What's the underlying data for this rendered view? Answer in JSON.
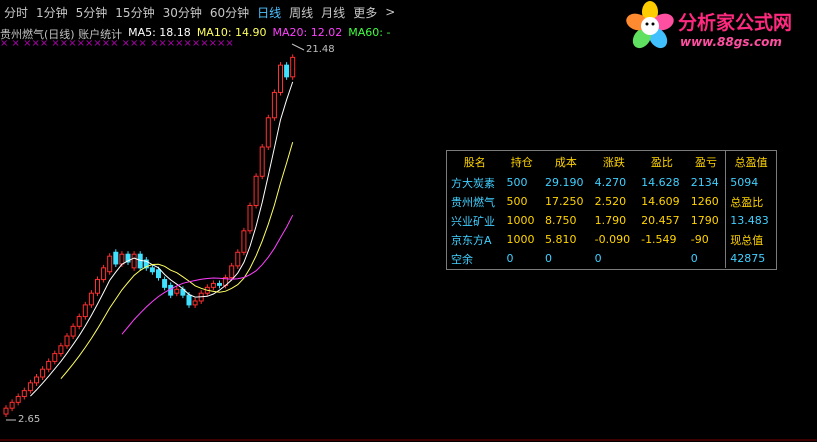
{
  "toolbar": {
    "items": [
      "分时",
      "1分钟",
      "5分钟",
      "15分钟",
      "30分钟",
      "60分钟",
      "日线",
      "周线",
      "月线",
      "更多"
    ],
    "active_index": 6,
    "more_chevron": ">"
  },
  "infobar": {
    "title": "贵州燃气(日线) 账户统计",
    "ma5": "MA5: 18.18",
    "ma10": "MA10: 14.90",
    "ma20": "MA20: 12.02",
    "ma60": "MA60: -",
    "colors": {
      "title": "#c0c0c0",
      "ma5": "#ffffff",
      "ma10": "#ffff60",
      "ma20": "#ff40ff",
      "ma60": "#40ff40"
    }
  },
  "marks": "×   ×  ×××    ××××××××      ×××    ××××××××××",
  "logo": {
    "text": "分析家公式网",
    "url": "www.88gs.com"
  },
  "price_labels": {
    "high": "21.48",
    "low": "2.65"
  },
  "stats": {
    "headers": [
      "股名",
      "持仓",
      "成本",
      "涨跌",
      "盈比",
      "盈亏"
    ],
    "rows": [
      [
        "方大炭素",
        "500",
        "29.190",
        "4.270",
        "14.628",
        "2134"
      ],
      [
        "贵州燃气",
        "500",
        "17.250",
        "2.520",
        "14.609",
        "1260"
      ],
      [
        "兴业矿业",
        "1000",
        "8.750",
        "1.790",
        "20.457",
        "1790"
      ],
      [
        "京东方A",
        "1000",
        "5.810",
        "-0.090",
        "-1.549",
        "-90"
      ],
      [
        "空余",
        "0",
        "0",
        "0",
        "",
        "0"
      ]
    ],
    "side": {
      "h1": "总盈值",
      "v1": "5094",
      "h2": "总盈比",
      "v2": "13.483",
      "h3": "现总值",
      "v3": "42875"
    }
  },
  "chart_data": {
    "type": "candlestick",
    "series": [
      {
        "o": 2.7,
        "c": 3.0
      },
      {
        "o": 3.0,
        "c": 3.3
      },
      {
        "o": 3.3,
        "c": 3.6
      },
      {
        "o": 3.6,
        "c": 3.9
      },
      {
        "o": 3.9,
        "c": 4.3
      },
      {
        "o": 4.3,
        "c": 4.6
      },
      {
        "o": 4.6,
        "c": 5.0
      },
      {
        "o": 5.0,
        "c": 5.4
      },
      {
        "o": 5.4,
        "c": 5.8
      },
      {
        "o": 5.8,
        "c": 6.2
      },
      {
        "o": 6.2,
        "c": 6.7
      },
      {
        "o": 6.7,
        "c": 7.2
      },
      {
        "o": 7.2,
        "c": 7.7
      },
      {
        "o": 7.7,
        "c": 8.3
      },
      {
        "o": 8.3,
        "c": 8.9
      },
      {
        "o": 8.9,
        "c": 9.6
      },
      {
        "o": 9.6,
        "c": 10.2
      },
      {
        "o": 10.0,
        "c": 10.8
      },
      {
        "o": 11.0,
        "c": 10.4
      },
      {
        "o": 10.4,
        "c": 10.9
      },
      {
        "o": 10.9,
        "c": 10.5
      },
      {
        "o": 10.2,
        "c": 10.9
      },
      {
        "o": 10.9,
        "c": 10.2
      },
      {
        "o": 10.6,
        "c": 10.2
      },
      {
        "o": 10.2,
        "c": 10.0
      },
      {
        "o": 10.1,
        "c": 9.7
      },
      {
        "o": 9.6,
        "c": 9.2
      },
      {
        "o": 9.3,
        "c": 8.8
      },
      {
        "o": 8.9,
        "c": 9.1
      },
      {
        "o": 9.1,
        "c": 8.8
      },
      {
        "o": 8.8,
        "c": 8.3
      },
      {
        "o": 8.3,
        "c": 8.5
      },
      {
        "o": 8.5,
        "c": 8.9
      },
      {
        "o": 8.9,
        "c": 9.2
      },
      {
        "o": 9.2,
        "c": 9.4
      },
      {
        "o": 9.4,
        "c": 9.3
      },
      {
        "o": 9.3,
        "c": 9.7
      },
      {
        "o": 9.7,
        "c": 10.3
      },
      {
        "o": 10.3,
        "c": 11.0
      },
      {
        "o": 11.0,
        "c": 12.1
      },
      {
        "o": 12.1,
        "c": 13.4
      },
      {
        "o": 13.4,
        "c": 14.9
      },
      {
        "o": 14.9,
        "c": 16.4
      },
      {
        "o": 16.4,
        "c": 17.9
      },
      {
        "o": 17.9,
        "c": 19.2
      },
      {
        "o": 19.2,
        "c": 20.6
      },
      {
        "o": 20.6,
        "c": 20.0
      },
      {
        "o": 20.0,
        "c": 21.0
      }
    ],
    "high": 21.48,
    "low": 2.65,
    "ma_colors": {
      "ma5": "#ffffff",
      "ma10": "#ffff60",
      "ma20": "#ff40ff"
    },
    "up_color": "#ff3030",
    "down_color": "#40e0ff"
  }
}
